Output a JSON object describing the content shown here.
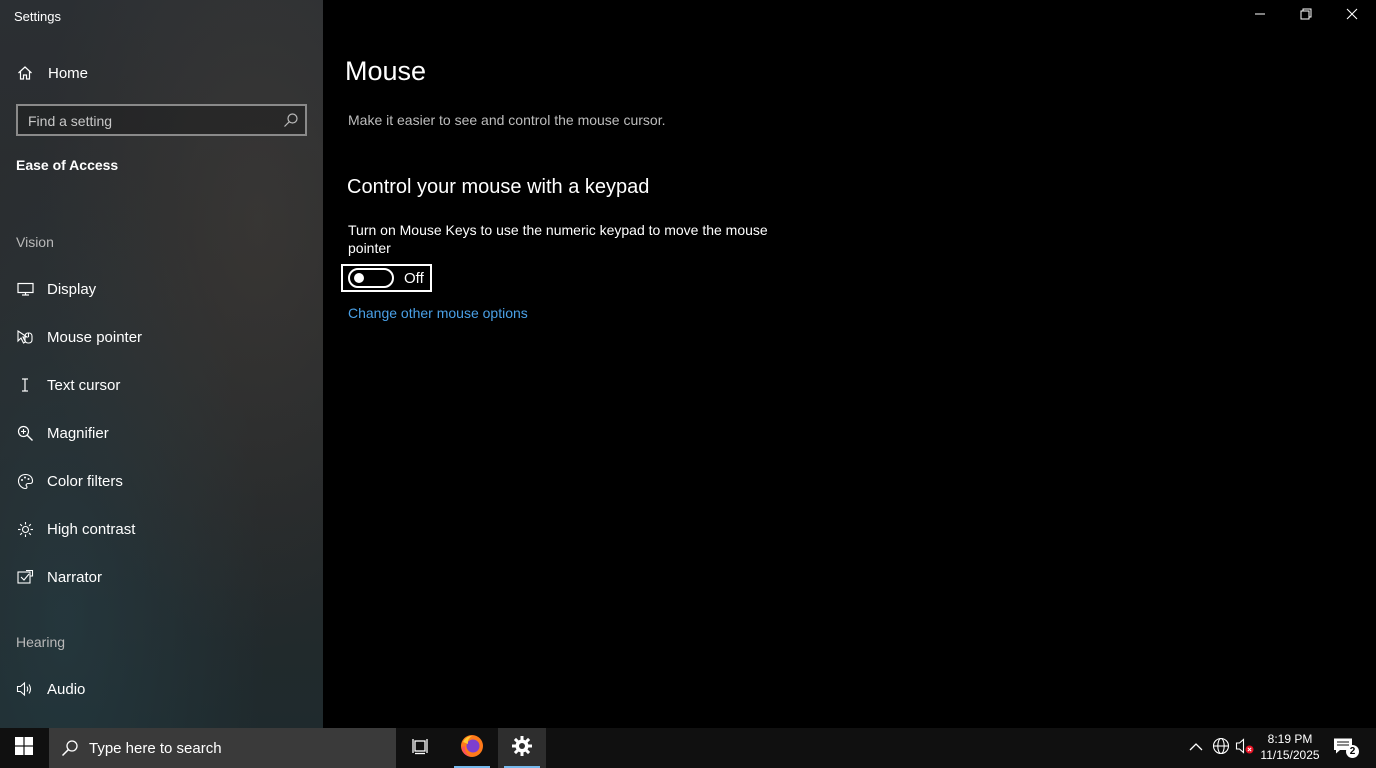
{
  "window": {
    "title": "Settings"
  },
  "sidebar": {
    "home_label": "Home",
    "search_placeholder": "Find a setting",
    "current_section": "Ease of Access",
    "groups": [
      {
        "header": "Vision"
      },
      {
        "header": "Hearing"
      }
    ],
    "items": [
      {
        "label": "Display",
        "icon": "monitor-icon"
      },
      {
        "label": "Mouse pointer",
        "icon": "mouse-pointer-icon"
      },
      {
        "label": "Text cursor",
        "icon": "text-cursor-icon"
      },
      {
        "label": "Magnifier",
        "icon": "magnifier-icon"
      },
      {
        "label": "Color filters",
        "icon": "color-filters-icon"
      },
      {
        "label": "High contrast",
        "icon": "high-contrast-icon"
      },
      {
        "label": "Narrator",
        "icon": "narrator-icon"
      },
      {
        "label": "Audio",
        "icon": "speaker-icon"
      }
    ]
  },
  "main": {
    "title": "Mouse",
    "subtitle": "Make it easier to see and control the mouse cursor.",
    "section_heading": "Control your mouse with a keypad",
    "toggle_description": "Turn on Mouse Keys to use the numeric keypad to move the mouse pointer",
    "toggle_state": "Off",
    "link_label": "Change other mouse options"
  },
  "taskbar": {
    "search_placeholder": "Type here to search",
    "time": "8:19 PM",
    "date": "11/15/2025",
    "notification_count": "2",
    "accent_color": "#76b9ed"
  }
}
